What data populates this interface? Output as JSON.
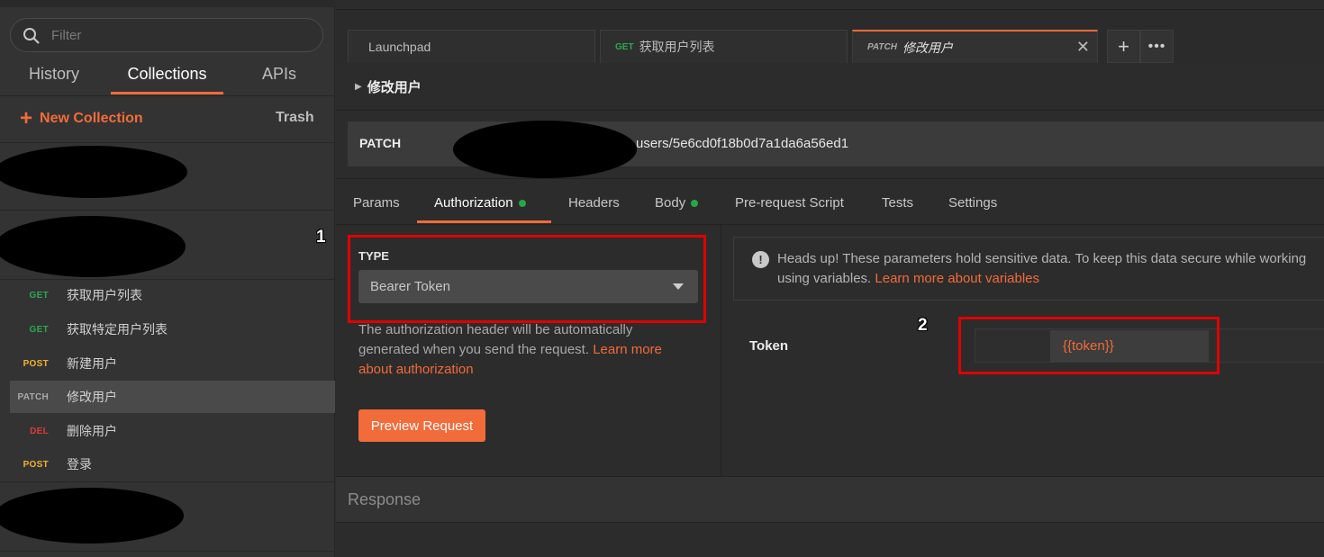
{
  "colors": {
    "accent": "#f26b3a",
    "get": "#2fa84f",
    "post": "#f2b134",
    "patch": "#aaaaaa",
    "del": "#e03a3a",
    "annotation": "#e00000"
  },
  "sidebar": {
    "filter_placeholder": "Filter",
    "tabs": [
      "History",
      "Collections",
      "APIs"
    ],
    "active_tab": "Collections",
    "new_collection_label": "New Collection",
    "trash_label": "Trash",
    "requests": [
      {
        "method": "GET",
        "name": "获取用户列表"
      },
      {
        "method": "GET",
        "name": "获取特定用户列表"
      },
      {
        "method": "POST",
        "name": "新建用户"
      },
      {
        "method": "PATCH",
        "name": "修改用户",
        "selected": true
      },
      {
        "method": "DEL",
        "name": "删除用户"
      },
      {
        "method": "POST",
        "name": "登录"
      }
    ]
  },
  "tabs": [
    {
      "label": "Launchpad",
      "method": ""
    },
    {
      "label": "获取用户列表",
      "method": "GET"
    },
    {
      "label": "修改用户",
      "method": "PATCH",
      "active": true
    }
  ],
  "request": {
    "name": "修改用户",
    "method": "PATCH",
    "url_visible": "users/5e6cd0f18b0d7a1da6a56ed1"
  },
  "param_tabs": [
    {
      "label": "Params"
    },
    {
      "label": "Authorization",
      "active": true,
      "dot": true
    },
    {
      "label": "Headers"
    },
    {
      "label": "Body",
      "dot": true
    },
    {
      "label": "Pre-request Script"
    },
    {
      "label": "Tests"
    },
    {
      "label": "Settings"
    }
  ],
  "auth": {
    "type_label": "TYPE",
    "type_value": "Bearer Token",
    "description": "The authorization header will be automatically generated when you send the request. ",
    "learn_more": "Learn more about authorization",
    "preview_button": "Preview Request",
    "headsup_line1": "Heads up! These parameters hold sensitive data. To keep this data secure while working",
    "headsup_line2_prefix": "using variables. ",
    "headsup_link": "Learn more about variables",
    "token_label": "Token",
    "token_value": "{{token}}"
  },
  "response_label": "Response",
  "annotations": [
    "1",
    "2"
  ]
}
